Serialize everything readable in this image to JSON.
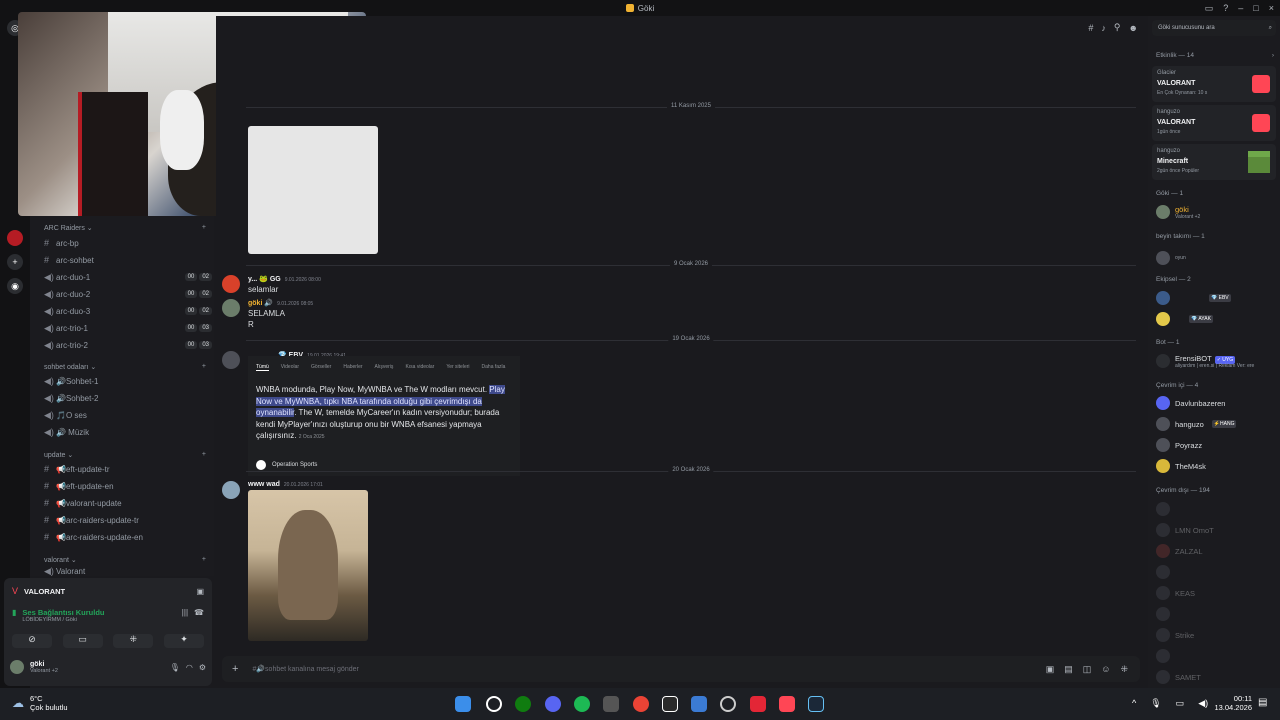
{
  "window": {
    "title": "Göki"
  },
  "header": {
    "search_placeholder": "Göki sunucusunu ara"
  },
  "sidebar": {
    "categories": [
      {
        "label": "ARC Raiders"
      },
      {
        "label": "sohbet odaları"
      },
      {
        "label": "update"
      },
      {
        "label": "valorant"
      }
    ],
    "arc_channels": [
      {
        "name": "arc-bp",
        "type": "text"
      },
      {
        "name": "arc-sohbet",
        "type": "text"
      },
      {
        "name": "arc-duo-1",
        "type": "voice",
        "c1": "00",
        "c2": "02"
      },
      {
        "name": "arc-duo-2",
        "type": "voice",
        "c1": "00",
        "c2": "02"
      },
      {
        "name": "arc-duo-3",
        "type": "voice",
        "c1": "00",
        "c2": "02"
      },
      {
        "name": "arc-trio-1",
        "type": "voice",
        "c1": "00",
        "c2": "03"
      },
      {
        "name": "arc-trio-2",
        "type": "voice",
        "c1": "00",
        "c2": "03"
      }
    ],
    "sohbet_channels": [
      {
        "name": "🔊Sohbet-1"
      },
      {
        "name": "🔊Sohbet-2"
      },
      {
        "name": "🎵O ses"
      },
      {
        "name": "🔊 Müzik"
      }
    ],
    "update_channels": [
      {
        "name": "📢eft-update-tr"
      },
      {
        "name": "📢eft-update-en"
      },
      {
        "name": "📢valorant-update"
      },
      {
        "name": "📢arc-raiders-update-tr"
      },
      {
        "name": "📢arc-raiders-update-en"
      }
    ],
    "valorant_channels": [
      {
        "name": "Valorant"
      }
    ]
  },
  "voice_panel": {
    "game": "VALORANT",
    "status": "Ses Bağlantısı Kuruldu",
    "location": "LÖBİDEYİRMM / Göki",
    "user_name": "göki",
    "user_status": "Valorant +2"
  },
  "chat": {
    "dates": [
      "11 Kasım 2025",
      "9 Ocak 2026",
      "19 Ocak 2026",
      "20 Ocak 2026"
    ],
    "messages": [
      {
        "author": "y... 🐸 GG",
        "time": "9.01.2026 08:00",
        "text": "selamlar"
      },
      {
        "author": "göki 🔊",
        "time": "9.01.2026 08:05",
        "text": "SELAMLA",
        "text2": "R"
      },
      {
        "author": "💎 EBV",
        "time": "19.01.2026 19:41",
        "text": ""
      },
      {
        "author": "www wad",
        "time": "20.01.2026 17:01",
        "text": ""
      }
    ],
    "embed": {
      "tabs": [
        "Tümü",
        "Videolar",
        "Görseller",
        "Haberler",
        "Alışveriş",
        "Kısa videolar",
        "Yer siteleri",
        "Daha fazla"
      ],
      "text_pre": "WNBA modunda, Play Now, MyWNBA ve The W modları mevcut. ",
      "text_hl": "Play Now ve MyWNBA, tıpkı NBA tarafında olduğu gibi çevrimdışı da oynanabilir",
      "text_post": ". The W, temelde MyCareer'ın kadın versiyonudur; burada kendi MyPlayer'ınızı oluşturup onu bir WNBA efsanesi yapmaya çalışırsınız.",
      "date": "2 Oca 2025",
      "source": "Operation Sports"
    },
    "composer_placeholder": "#🔊sohbet kanalına mesaj gönder"
  },
  "members": {
    "activity_header": "Etkinlik — 14",
    "activities": [
      {
        "user": "Glacier",
        "game": "VALORANT",
        "sub": "En Çok Oynanan: 10 s"
      },
      {
        "user": "hanguzo",
        "game": "VALORANT",
        "sub": "1gün önce"
      },
      {
        "user": "hanguzo",
        "game": "Minecraft",
        "sub": "2gün önce  Popüler"
      }
    ],
    "groups": [
      {
        "header": "Göki — 1",
        "members": [
          {
            "name": "göki",
            "sub": "Valorant +2",
            "tag": ""
          }
        ]
      },
      {
        "header": "beyin takımı — 1",
        "members": [
          {
            "name": "",
            "sub": "oyun",
            "tag": ""
          }
        ]
      },
      {
        "header": "Ekipsel — 2",
        "members": [
          {
            "name": "",
            "sub": "",
            "tag": "💎 EBV"
          },
          {
            "name": "",
            "sub": "",
            "tag": "💎 AYAK"
          }
        ]
      },
      {
        "header": "Bot — 1",
        "members": [
          {
            "name": "ErensiBOT",
            "sub": "aliyardım | eren.si | Reklam Ver: ere",
            "tag": "✓ UYG"
          }
        ]
      },
      {
        "header": "Çevrim içi — 4",
        "members": [
          {
            "name": "Davlunbazeren",
            "sub": "",
            "tag": ""
          },
          {
            "name": "hanguzo",
            "sub": "",
            "tag": "⚡HANG"
          },
          {
            "name": "Poyrazz",
            "sub": "",
            "tag": ""
          },
          {
            "name": "TheM4sk",
            "sub": "",
            "tag": ""
          }
        ]
      },
      {
        "header": "Çevrim dışı — 194",
        "members": [
          {
            "name": "",
            "sub": "",
            "tag": ""
          },
          {
            "name": "LMN OmoT",
            "sub": "",
            "tag": ""
          },
          {
            "name": "ZALZAL",
            "sub": "",
            "tag": ""
          },
          {
            "name": "",
            "sub": "",
            "tag": ""
          },
          {
            "name": "KEAS",
            "sub": "",
            "tag": ""
          },
          {
            "name": "",
            "sub": "",
            "tag": ""
          },
          {
            "name": "Strike",
            "sub": "",
            "tag": ""
          },
          {
            "name": "",
            "sub": "",
            "tag": ""
          },
          {
            "name": "SAMET",
            "sub": "",
            "tag": ""
          }
        ]
      }
    ]
  },
  "taskbar": {
    "weather_temp": "6°C",
    "weather_desc": "Çok bulutlu",
    "time": "00:11",
    "date": "13.04.2026"
  },
  "colors": {
    "accent": "#5865f2",
    "highlight": "#3f4a8c",
    "online": "#23a55a",
    "valorant": "#ff4655"
  }
}
